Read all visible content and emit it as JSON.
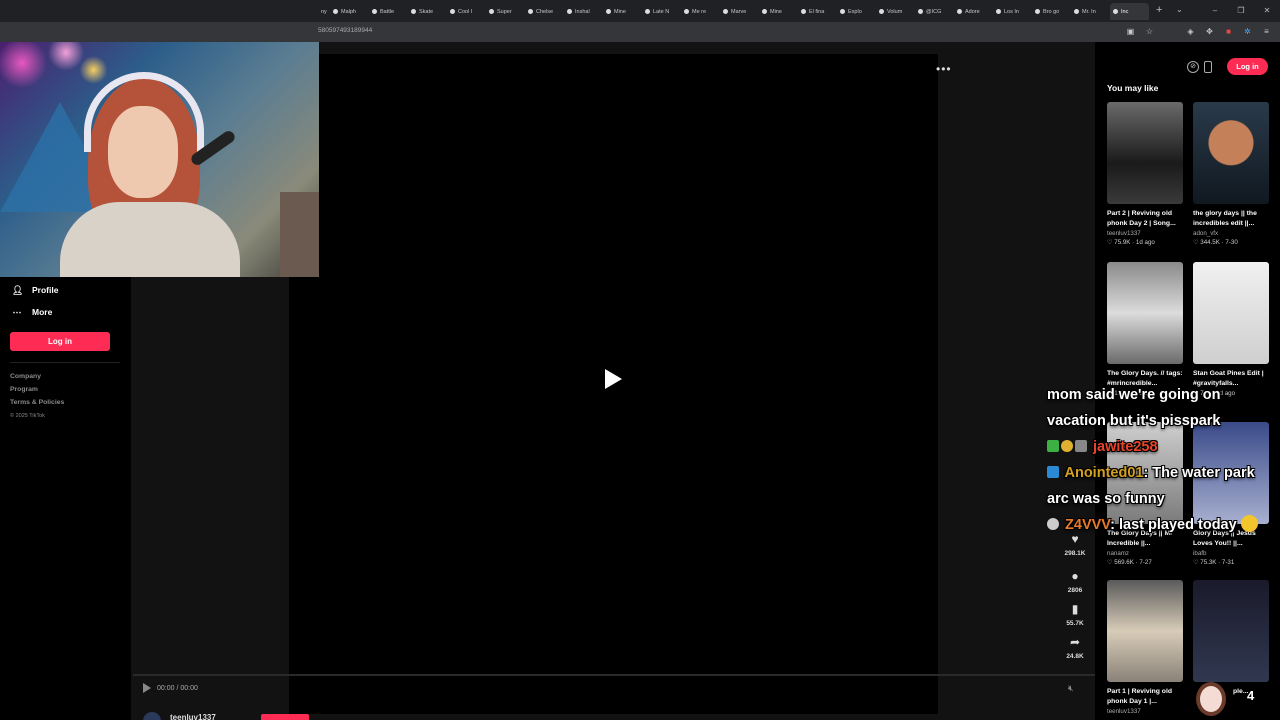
{
  "browser": {
    "tabs": [
      {
        "label": "ny"
      },
      {
        "label": "Malph"
      },
      {
        "label": "Battle"
      },
      {
        "label": "Skate"
      },
      {
        "label": "Cool I"
      },
      {
        "label": "Super"
      },
      {
        "label": "Chelse"
      },
      {
        "label": "Inshal"
      },
      {
        "label": "Mine"
      },
      {
        "label": "Late N"
      },
      {
        "label": "Me re"
      },
      {
        "label": "Marve"
      },
      {
        "label": "Mine"
      },
      {
        "label": "El fina"
      },
      {
        "label": "Explo"
      },
      {
        "label": "Volum"
      },
      {
        "label": "@ICG"
      },
      {
        "label": "Adore"
      },
      {
        "label": "Los In"
      },
      {
        "label": "Bro go"
      },
      {
        "label": "Mr. In"
      },
      {
        "label": "Inc"
      }
    ],
    "url": "580597493189944",
    "new_tab": "+",
    "tab_list": "⌄",
    "window_controls": {
      "minimize": "–",
      "maximize": "❐",
      "close": "✕"
    }
  },
  "sidebar": {
    "profile_label": "Profile",
    "more_label": "More",
    "login_label": "Log in",
    "links": [
      "Company",
      "Program",
      "Terms & Policies"
    ],
    "copyright": "© 2025 TikTok"
  },
  "video": {
    "more_label": "•••",
    "time": "00:00 / 00:00",
    "stats": {
      "likes": "298.1K",
      "comments": "2806",
      "saves": "55.7K",
      "shares": "24.8K"
    },
    "author": "teenluv1337"
  },
  "right_panel": {
    "login_label": "Log in",
    "section_title": "You may like",
    "cards": [
      {
        "title": "Part 2 | Reviving old phonk Day 2 | Song...",
        "author": "teenluv1337",
        "meta": "♡ 75.9K · 1d ago"
      },
      {
        "title": "the glory days || the incredibles edit ||...",
        "author": "adon_vfx",
        "meta": "♡ 344.5K · 7-30"
      },
      {
        "title": "The Glory Days. // tags: #mrincredible...",
        "author": "",
        "meta": "♡ 189.8K · 8-12"
      },
      {
        "title": "Stan Goat Pines Edit | #gravityfalls...",
        "author": "",
        "meta": "♡ 773 · 2d ago"
      },
      {
        "title": "The Glory Days || Mr Incredible ||...",
        "author": "nanamz",
        "meta": "♡ 569.6K · 7-27"
      },
      {
        "title": "Glory Days || Jesus Loves You!! ||...",
        "author": "ibafb",
        "meta": "♡ 75.3K · 7-31"
      },
      {
        "title": "Part 1 | Reviving old phonk Day 1 |...",
        "author": "teenluv1337",
        "meta": ""
      },
      {
        "title": "ple...",
        "author": "",
        "meta": ""
      }
    ]
  },
  "chat": {
    "messages": [
      {
        "user": "",
        "text": "mom said we're going on vacation but it's pisspark",
        "user_color": "#ffffff"
      },
      {
        "user": "jawite258",
        "text": "",
        "user_color": "#e8452a"
      },
      {
        "user": "Anointed01",
        "text": ": The water park arc was so funny",
        "user_color": "#d4a020"
      },
      {
        "user": "Z4VVV",
        "text": ": last played today",
        "user_color": "#e87a2a"
      }
    ]
  },
  "overlay_counter": "4"
}
